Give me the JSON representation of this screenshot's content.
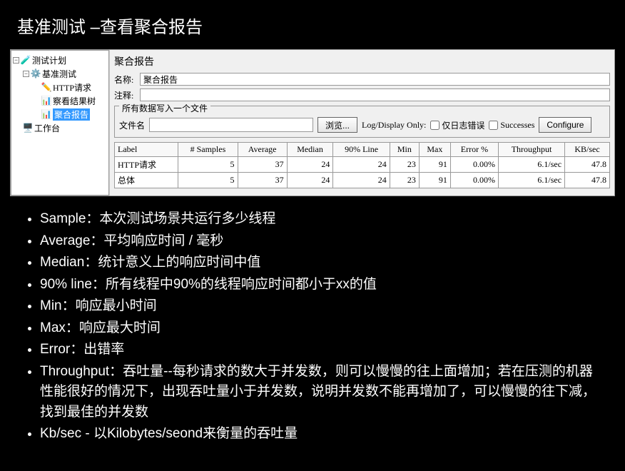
{
  "slide_title": "基准测试 –查看聚合报告",
  "tree": {
    "root": "测试计划",
    "nodes": [
      {
        "label": "基准测试",
        "icon": "🧪"
      },
      {
        "label": "HTTP请求",
        "icon": "✏️"
      },
      {
        "label": "察看结果树",
        "icon": "📊"
      },
      {
        "label": "聚合报告",
        "icon": "📊",
        "selected": true
      },
      {
        "label": "工作台",
        "icon": "🖥️"
      }
    ]
  },
  "report": {
    "title": "聚合报告",
    "name_label": "名称:",
    "name_value": "聚合报告",
    "comment_label": "注释:",
    "comment_value": "",
    "file_legend": "所有数据写入一个文件",
    "file_label": "文件名",
    "browse_btn": "浏览...",
    "log_display": "Log/Display Only:",
    "chk_errors": "仅日志错误",
    "chk_success": "Successes",
    "configure_btn": "Configure"
  },
  "table": {
    "headers": [
      "Label",
      "# Samples",
      "Average",
      "Median",
      "90% Line",
      "Min",
      "Max",
      "Error %",
      "Throughput",
      "KB/sec"
    ],
    "rows": [
      [
        "HTTP请求",
        "5",
        "37",
        "24",
        "24",
        "23",
        "91",
        "0.00%",
        "6.1/sec",
        "47.8"
      ],
      [
        "总体",
        "5",
        "37",
        "24",
        "24",
        "23",
        "91",
        "0.00%",
        "6.1/sec",
        "47.8"
      ]
    ]
  },
  "bullets": [
    "Sample：本次测试场景共运行多少线程",
    " Average：平均响应时间  / 毫秒",
    " Median：统计意义上的响应时间中值",
    " 90% line：所有线程中90%的线程响应时间都小于xx的值",
    "Min：响应最小时间",
    "Max：响应最大时间",
    "Error：出错率",
    "Throughput：吞吐量--每秒请求的数大于并发数，则可以慢慢的往上面增加；若在压测的机器性能很好的情况下，出现吞吐量小于并发数，说明并发数不能再增加了，可以慢慢的往下减，找到最佳的并发数",
    " Kb/sec - 以Kilobytes/seond来衡量的吞吐量"
  ]
}
